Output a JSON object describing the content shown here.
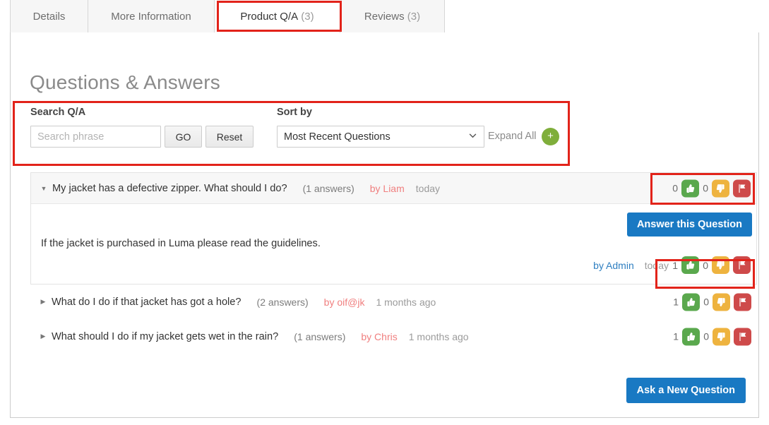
{
  "tabs": [
    {
      "label": "Details",
      "count": "",
      "active": false
    },
    {
      "label": "More Information",
      "count": "",
      "active": false
    },
    {
      "label": "Product Q/A",
      "count": "(3)",
      "active": true
    },
    {
      "label": "Reviews",
      "count": "(3)",
      "active": false
    }
  ],
  "heading": "Questions & Answers",
  "filters": {
    "search_label": "Search Q/A",
    "search_value": "",
    "search_placeholder": "Search phrase",
    "go_label": "GO",
    "reset_label": "Reset",
    "sort_label": "Sort by",
    "sort_selected": "Most Recent Questions",
    "expand_all_label": "Expand All",
    "expand_plus_label": "+"
  },
  "questions": [
    {
      "expanded": true,
      "arrow": "▼",
      "text": "My jacket has a defective zipper. What should I do?",
      "answers_count": "(1 answers)",
      "author": "by Liam",
      "date": "today",
      "up_count": "0",
      "down_count": "0",
      "answer_button": "Answer this Question",
      "answer_text": "If the jacket is purchased in Luma please read the guidelines.",
      "answer_author": "by Admin",
      "answer_date": "today",
      "answer_up_count": "1",
      "answer_down_count": "0"
    },
    {
      "expanded": false,
      "arrow": "▶",
      "text": "What do I do if that jacket has got a hole?",
      "answers_count": "(2 answers)",
      "author": "by oif@jk",
      "date": "1 months ago",
      "up_count": "1",
      "down_count": "0"
    },
    {
      "expanded": false,
      "arrow": "▶",
      "text": "What should I do if my jacket gets wet in the rain?",
      "answers_count": "(1 answers)",
      "author": "by Chris",
      "date": "1 months ago",
      "up_count": "1",
      "down_count": "0"
    }
  ],
  "ask_button": "Ask a New Question",
  "colors": {
    "annotation": "#e2231a",
    "primary_button": "#1979c3",
    "thumb_up": "#5aa84d",
    "thumb_down": "#eeb33f",
    "flag": "#ce4a4a",
    "expand_plus": "#7fae3b",
    "author_link": "#f07f7f"
  }
}
